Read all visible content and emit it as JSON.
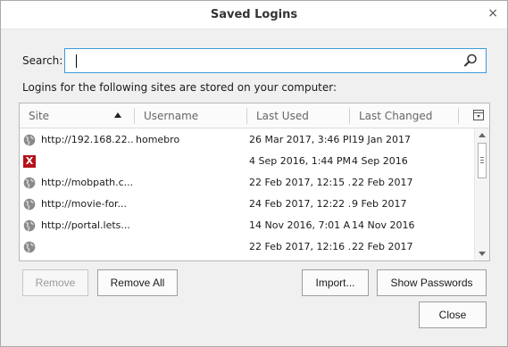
{
  "window": {
    "title": "Saved Logins",
    "close_glyph": "×"
  },
  "search": {
    "label": "Search:",
    "value": ""
  },
  "info_text": "Logins for the following sites are stored on your computer:",
  "columns": [
    "Site",
    "Username",
    "Last Used",
    "Last Changed"
  ],
  "rows": [
    {
      "icon": "globe-icon",
      "site": "http://192.168.22....",
      "username": "homebro",
      "last_used": "26 Mar 2017, 3:46 PM",
      "last_changed": "19 Jan 2017"
    },
    {
      "icon": "red-x-icon",
      "icon_text": "X",
      "site": "",
      "username": "",
      "last_used": "4 Sep 2016, 1:44 PM",
      "last_changed": "4 Sep 2016"
    },
    {
      "icon": "globe-icon",
      "site": "http://mobpath.c...",
      "username": "",
      "last_used": "22 Feb 2017, 12:15 ...",
      "last_changed": "22 Feb 2017"
    },
    {
      "icon": "globe-icon",
      "site": "http://movie-for...",
      "username": "",
      "last_used": "24 Feb 2017, 12:22 ...",
      "last_changed": "9 Feb 2017"
    },
    {
      "icon": "globe-icon",
      "site": "http://portal.lets...",
      "username": "",
      "last_used": "14 Nov 2016, 7:01 A...",
      "last_changed": "14 Nov 2016"
    },
    {
      "icon": "globe-icon",
      "site": "",
      "username": "",
      "last_used": "22 Feb 2017, 12:16 ...",
      "last_changed": "22 Feb 2017"
    }
  ],
  "buttons": {
    "remove": "Remove",
    "remove_all": "Remove All",
    "import": "Import...",
    "show_passwords": "Show Passwords",
    "close": "Close"
  },
  "colors": {
    "accent_border": "#3c9ad8",
    "red_icon": "#b5121b"
  }
}
